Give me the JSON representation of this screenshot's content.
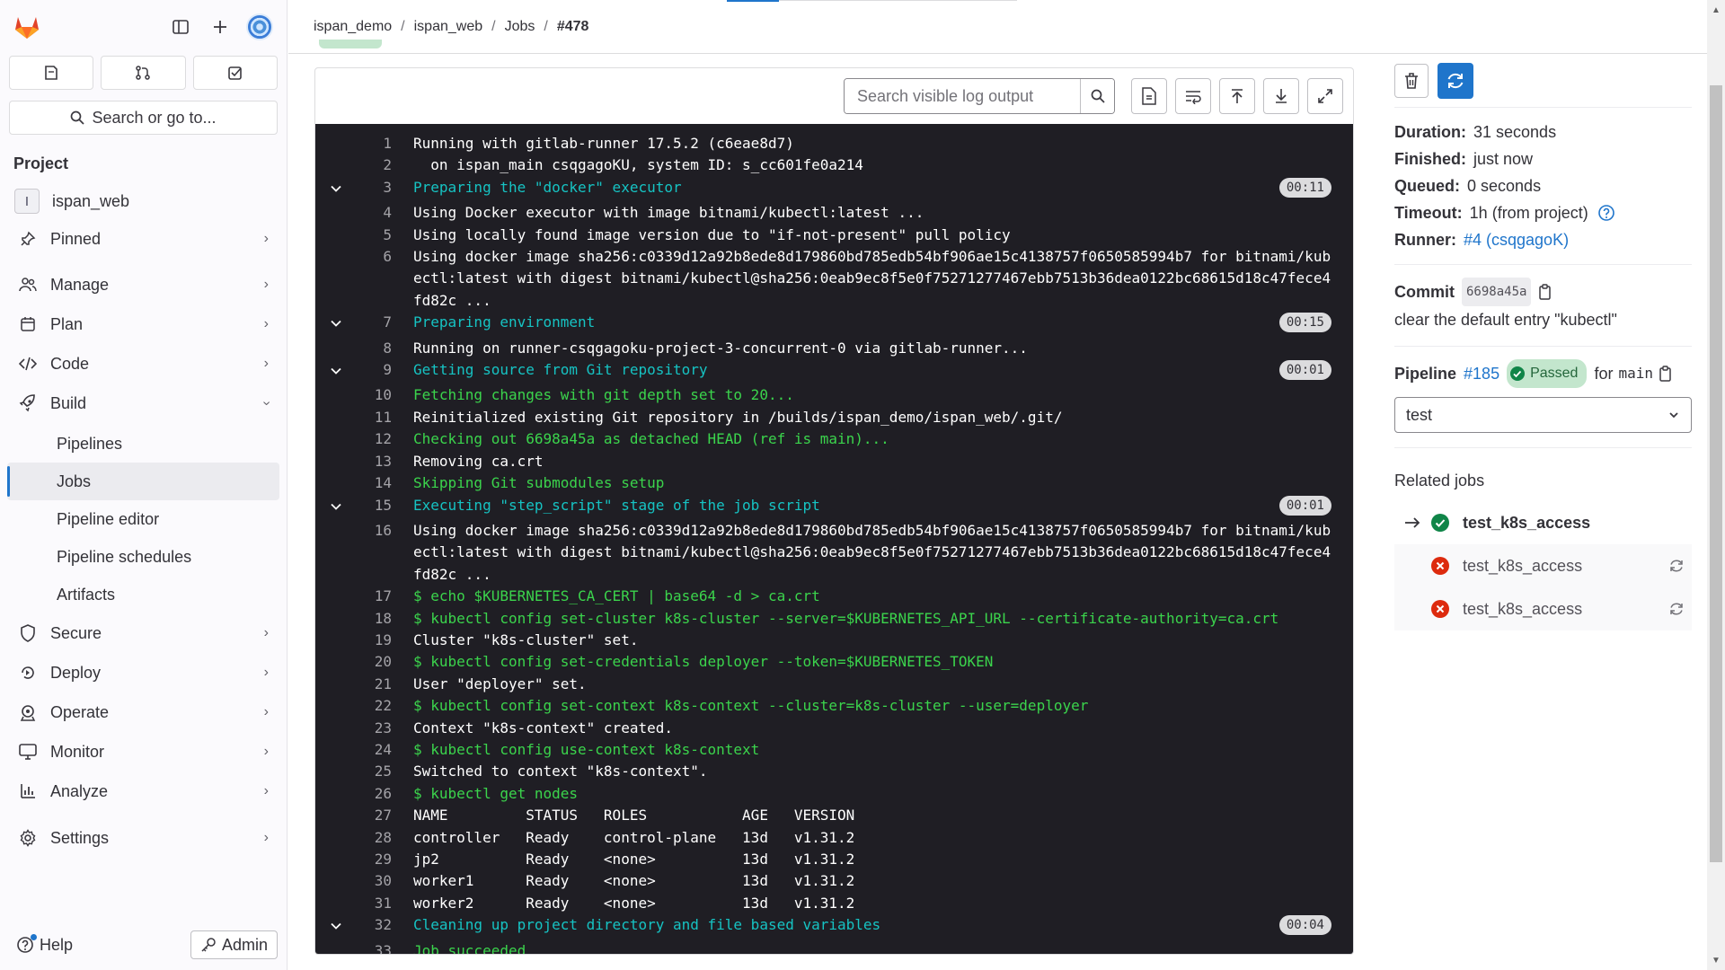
{
  "colors": {
    "accent": "#1f75cb",
    "success": "#108548",
    "danger": "#dd2b0e",
    "log_bg": "#1f1e24"
  },
  "sidebar": {
    "search_label": "Search or go to...",
    "section_title": "Project",
    "project": {
      "initial": "I",
      "name": "ispan_web"
    },
    "nav": [
      {
        "label": "Pinned",
        "icon": "pin-icon"
      },
      {
        "label": "Manage",
        "icon": "users-icon"
      },
      {
        "label": "Plan",
        "icon": "calendar-icon"
      },
      {
        "label": "Code",
        "icon": "code-icon"
      },
      {
        "label": "Build",
        "icon": "rocket-icon"
      }
    ],
    "build_sub": [
      "Pipelines",
      "Jobs",
      "Pipeline editor",
      "Pipeline schedules",
      "Artifacts"
    ],
    "nav2": [
      {
        "label": "Secure",
        "icon": "shield-icon"
      },
      {
        "label": "Deploy",
        "icon": "deploy-icon"
      },
      {
        "label": "Operate",
        "icon": "cloud-icon"
      },
      {
        "label": "Monitor",
        "icon": "monitor-icon"
      },
      {
        "label": "Analyze",
        "icon": "chart-icon"
      }
    ],
    "settings_label": "Settings",
    "help_label": "Help",
    "admin_label": "Admin"
  },
  "breadcrumb": [
    "ispan_demo",
    "ispan_web",
    "Jobs",
    "#478"
  ],
  "log": {
    "search_placeholder": "Search visible log output",
    "lines": [
      {
        "n": "1",
        "t": "Running with gitlab-runner 17.5.2 (c6eae8d7)"
      },
      {
        "n": "2",
        "t": "  on ispan_main csqgagoKU, system ID: s_cc601fe0a214"
      },
      {
        "n": "3",
        "t": "Preparing the \"docker\" executor",
        "section": true,
        "dur": "00:11"
      },
      {
        "n": "4",
        "t": "Using Docker executor with image bitnami/kubectl:latest ..."
      },
      {
        "n": "5",
        "t": "Using locally found image version due to \"if-not-present\" pull policy"
      },
      {
        "n": "6",
        "t": "Using docker image sha256:c0339d12a92b8ede8d179860bd785edb54bf906ae15c4138757f0650585994b7 for bitnami/kubectl:latest with digest bitnami/kubectl@sha256:0eab9ec8f5e0f75271277467ebb7513b36dea0122bc68615d18c47fece4fd82c ..."
      },
      {
        "n": "7",
        "t": "Preparing environment",
        "section": true,
        "dur": "00:15"
      },
      {
        "n": "8",
        "t": "Running on runner-csqgagoku-project-3-concurrent-0 via gitlab-runner..."
      },
      {
        "n": "9",
        "t": "Getting source from Git repository",
        "section": true,
        "dur": "00:01"
      },
      {
        "n": "10",
        "t": "Fetching changes with git depth set to 20...",
        "color": "green"
      },
      {
        "n": "11",
        "t": "Reinitialized existing Git repository in /builds/ispan_demo/ispan_web/.git/"
      },
      {
        "n": "12",
        "t": "Checking out 6698a45a as detached HEAD (ref is main)...",
        "color": "green"
      },
      {
        "n": "13",
        "t": "Removing ca.crt"
      },
      {
        "n": "14",
        "t": "Skipping Git submodules setup",
        "color": "green"
      },
      {
        "n": "15",
        "t": "Executing \"step_script\" stage of the job script",
        "section": true,
        "dur": "00:01"
      },
      {
        "n": "16",
        "t": "Using docker image sha256:c0339d12a92b8ede8d179860bd785edb54bf906ae15c4138757f0650585994b7 for bitnami/kubectl:latest with digest bitnami/kubectl@sha256:0eab9ec8f5e0f75271277467ebb7513b36dea0122bc68615d18c47fece4fd82c ..."
      },
      {
        "n": "17",
        "t": "$ echo $KUBERNETES_CA_CERT | base64 -d > ca.crt",
        "color": "green"
      },
      {
        "n": "18",
        "t": "$ kubectl config set-cluster k8s-cluster --server=$KUBERNETES_API_URL --certificate-authority=ca.crt",
        "color": "green"
      },
      {
        "n": "19",
        "t": "Cluster \"k8s-cluster\" set."
      },
      {
        "n": "20",
        "t": "$ kubectl config set-credentials deployer --token=$KUBERNETES_TOKEN",
        "color": "green"
      },
      {
        "n": "21",
        "t": "User \"deployer\" set."
      },
      {
        "n": "22",
        "t": "$ kubectl config set-context k8s-context --cluster=k8s-cluster --user=deployer",
        "color": "green"
      },
      {
        "n": "23",
        "t": "Context \"k8s-context\" created."
      },
      {
        "n": "24",
        "t": "$ kubectl config use-context k8s-context",
        "color": "green"
      },
      {
        "n": "25",
        "t": "Switched to context \"k8s-context\"."
      },
      {
        "n": "26",
        "t": "$ kubectl get nodes",
        "color": "green"
      },
      {
        "n": "27",
        "t": "NAME         STATUS   ROLES           AGE   VERSION"
      },
      {
        "n": "28",
        "t": "controller   Ready    control-plane   13d   v1.31.2"
      },
      {
        "n": "29",
        "t": "jp2          Ready    <none>          13d   v1.31.2"
      },
      {
        "n": "30",
        "t": "worker1      Ready    <none>          13d   v1.31.2"
      },
      {
        "n": "31",
        "t": "worker2      Ready    <none>          13d   v1.31.2"
      },
      {
        "n": "32",
        "t": "Cleaning up project directory and file based variables",
        "section": true,
        "dur": "00:04"
      },
      {
        "n": "33",
        "t": "Job succeeded",
        "color": "green"
      }
    ]
  },
  "details": {
    "duration_label": "Duration:",
    "duration": "31 seconds",
    "finished_label": "Finished:",
    "finished": "just now",
    "queued_label": "Queued:",
    "queued": "0 seconds",
    "timeout_label": "Timeout:",
    "timeout": "1h (from project)",
    "runner_label": "Runner:",
    "runner": "#4 (csqgagoK)",
    "commit_label": "Commit",
    "commit_sha": "6698a45a",
    "commit_message": "clear the default entry \"kubectl\"",
    "pipeline_label": "Pipeline",
    "pipeline_id": "#185",
    "pipeline_status": "Passed",
    "for_label": "for",
    "branch": "main",
    "stage": "test",
    "related_title": "Related jobs",
    "related": [
      {
        "name": "test_k8s_access",
        "status": "success",
        "current": true
      },
      {
        "name": "test_k8s_access",
        "status": "failed",
        "current": false
      },
      {
        "name": "test_k8s_access",
        "status": "failed",
        "current": false
      }
    ]
  }
}
